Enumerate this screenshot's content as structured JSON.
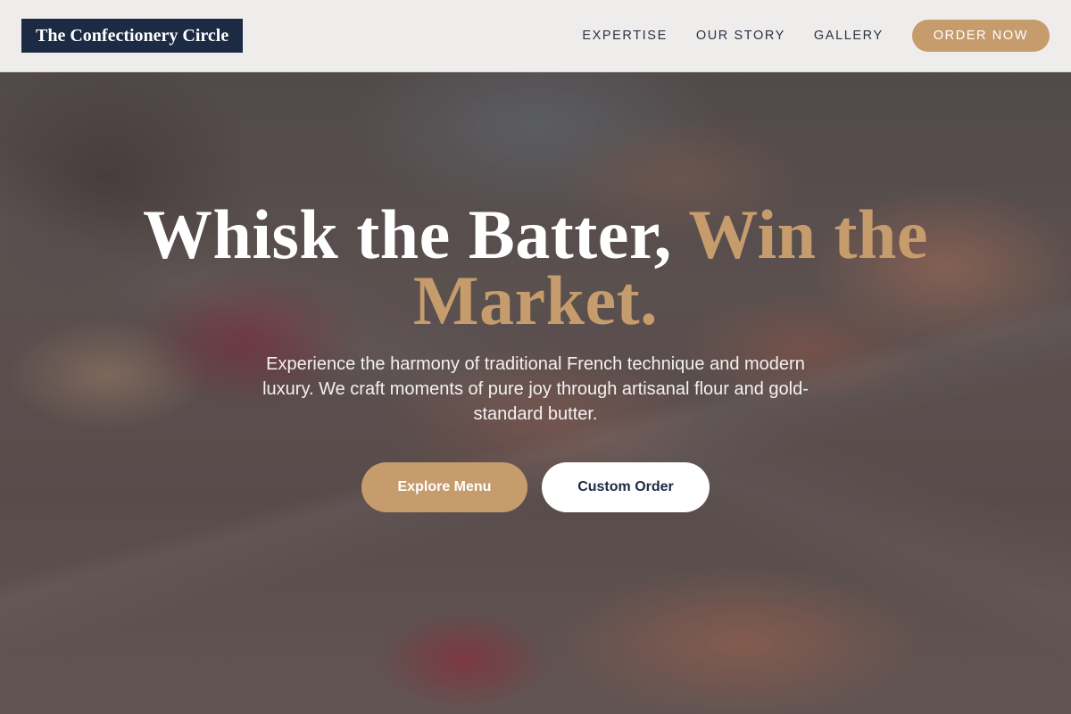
{
  "header": {
    "logo": "The Confectionery Circle",
    "nav": {
      "expertise": "EXPERTISE",
      "our_story": "OUR STORY",
      "gallery": "GALLERY"
    },
    "cta": "ORDER NOW"
  },
  "hero": {
    "title_main": "Whisk the Batter,",
    "title_accent": "Win the Market.",
    "subtitle": "Experience the harmony of traditional French technique and modern luxury. We craft moments of pure joy through artisanal flour and gold-standard butter.",
    "buttons": {
      "primary": "Explore Menu",
      "secondary": "Custom Order"
    }
  },
  "colors": {
    "navy": "#1c2a44",
    "gold": "#c69c6d",
    "header_bg": "#f5f3f1"
  }
}
